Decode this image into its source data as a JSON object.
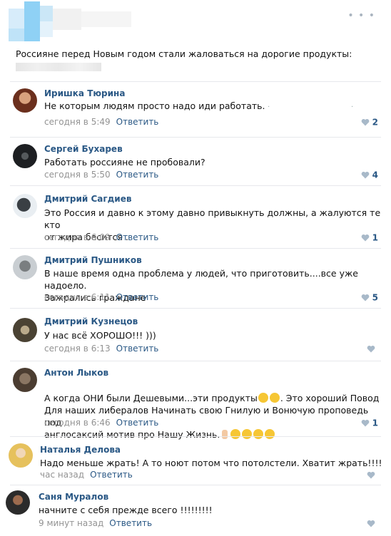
{
  "post": {
    "text": "Россияне перед Новым годом стали жаловаться на дорогие продукты:"
  },
  "menu_icon": "more-dots-icon",
  "comments": [
    {
      "author": "Иришка Тюрина",
      "text": "Не которым людям просто надо иди работать.",
      "time": "сегодня в 5:49",
      "reply": "Ответить",
      "likes": "2"
    },
    {
      "author": "Сергей Бухарев",
      "text": "Работать россияне не пробовали?",
      "time": "сегодня в 5:50",
      "reply": "Ответить",
      "likes": "4"
    },
    {
      "author": "Дмитрий Сагдиев",
      "text": "Это Россия и давно к этому давно привыкнуть должны, а жалуются те кто\nот жира бесится .",
      "time": "сегодня в 6:09",
      "reply": "Ответить",
      "likes": "1"
    },
    {
      "author": "Дмитрий Пушников",
      "text": "В наше время одна проблема у людей, что приготовить....все уже надоело.\nЗажрались граждане",
      "time": "сегодня в 6:11",
      "reply": "Ответить",
      "likes": "5"
    },
    {
      "author": "Дмитрий Кузнецов",
      "text": "У нас всё ХОРОШО!!! )))",
      "time": "сегодня в 6:13",
      "reply": "Ответить",
      "likes": ""
    },
    {
      "author": "Антон Лыков",
      "text_a": "А когда ОНИ были Дешевыми...эти продукты",
      "text_b": ". Это хороший Повод\nДля наших либералов Начинать свою Гнилую и Вонючую проповедь под\nанглосаксий мотив про Нашу Жизнь.",
      "time": "сегодня в 6:46",
      "reply": "Ответить",
      "likes": "1"
    },
    {
      "author": "Наталья Делова",
      "text": "Надо меньше жрать! А то ноют потом что потолстели. Хватит жрать!!!!",
      "time": "час назад",
      "reply": "Ответить",
      "likes": ""
    },
    {
      "author": "Саня Муралов",
      "text": "начните с себя прежде всего !!!!!!!!!",
      "time": "9 минут назад",
      "reply": "Ответить",
      "likes": ""
    }
  ]
}
